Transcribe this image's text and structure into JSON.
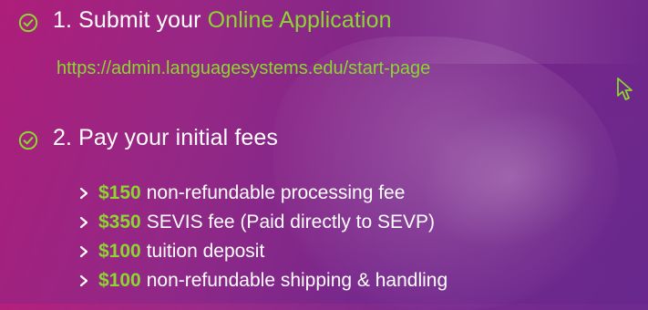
{
  "steps": [
    {
      "prefix": "1. Submit your ",
      "highlight": "Online Application"
    },
    {
      "prefix": "2. Pay your initial fees",
      "highlight": ""
    }
  ],
  "application_url": "https://admin.languagesystems.edu/start-page",
  "fees": [
    {
      "amount": "$150",
      "description": "non-refundable processing fee"
    },
    {
      "amount": "$350",
      "description": "SEVIS fee (Paid directly to SEVP)"
    },
    {
      "amount": "$100",
      "description": "tuition deposit"
    },
    {
      "amount": "$100",
      "description": "non-refundable shipping & handling"
    }
  ],
  "colors": {
    "accent": "#8bd62f",
    "text": "#ffffff",
    "background_left": "#b3207c",
    "background_right": "#6a2a8f"
  },
  "icons": [
    "check-circle-icon",
    "chevron-right-icon",
    "pointer-cursor-icon"
  ]
}
